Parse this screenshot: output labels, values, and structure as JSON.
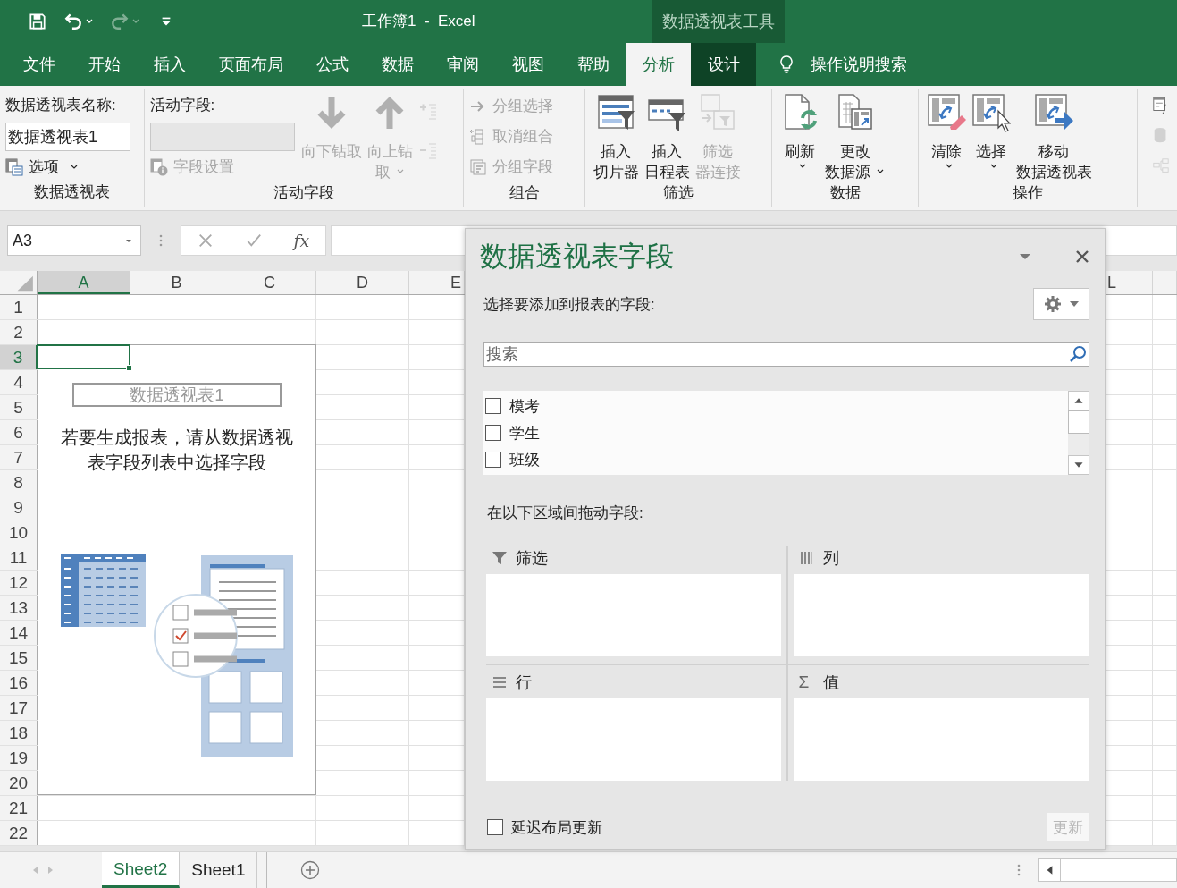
{
  "window": {
    "title": "工作簿1  -  Excel",
    "context_title": "数据透视表工具"
  },
  "quick_access": [
    {
      "kind": "save",
      "disabled": false
    },
    {
      "kind": "undo",
      "disabled": false
    },
    {
      "kind": "redo",
      "disabled": true
    },
    {
      "kind": "customize",
      "disabled": false
    }
  ],
  "tabs": [
    {
      "label": "文件",
      "selected": false,
      "contextual": false
    },
    {
      "label": "开始",
      "selected": false,
      "contextual": false
    },
    {
      "label": "插入",
      "selected": false,
      "contextual": false
    },
    {
      "label": "页面布局",
      "selected": false,
      "contextual": false
    },
    {
      "label": "公式",
      "selected": false,
      "contextual": false
    },
    {
      "label": "数据",
      "selected": false,
      "contextual": false
    },
    {
      "label": "审阅",
      "selected": false,
      "contextual": false
    },
    {
      "label": "视图",
      "selected": false,
      "contextual": false
    },
    {
      "label": "帮助",
      "selected": false,
      "contextual": false
    },
    {
      "label": "分析",
      "selected": true,
      "contextual": true
    },
    {
      "label": "设计",
      "selected": false,
      "contextual": true
    }
  ],
  "tell_me": "操作说明搜索",
  "ribbon": {
    "groups": [
      {
        "kind": "pivot",
        "label": "数据透视表",
        "name_label": "数据透视表名称:",
        "name_value": "数据透视表1",
        "options": {
          "kind": "options",
          "label": "选项",
          "dropdown": true,
          "disabled": false
        }
      },
      {
        "kind": "active-field",
        "label": "活动字段",
        "field_label": "活动字段:",
        "settings": {
          "kind": "field-settings",
          "label": "字段设置",
          "disabled": true
        },
        "items": [
          {
            "kind": "drill-down",
            "lines": [
              "向下钻取"
            ],
            "dropdown": false,
            "disabled": true
          },
          {
            "kind": "drill-up",
            "lines": [
              "向上钻",
              "取"
            ],
            "dropdown": true,
            "disabled": true
          }
        ],
        "small": [
          {
            "kind": "expand",
            "disabled": true
          },
          {
            "kind": "collapse",
            "disabled": true
          }
        ]
      },
      {
        "kind": "small-list",
        "label": "组合",
        "items": [
          {
            "kind": "group-selection",
            "label": "分组选择",
            "disabled": true
          },
          {
            "kind": "ungroup",
            "label": "取消组合",
            "disabled": true
          },
          {
            "kind": "group-field",
            "label": "分组字段",
            "disabled": true
          }
        ]
      },
      {
        "kind": "large",
        "label": "筛选",
        "items": [
          {
            "kind": "slicer",
            "lines": [
              "插入",
              "切片器"
            ],
            "dropdown": false,
            "disabled": false
          },
          {
            "kind": "timeline",
            "lines": [
              "插入",
              "日程表"
            ],
            "dropdown": false,
            "disabled": false
          },
          {
            "kind": "filter-connection",
            "lines": [
              "筛选",
              "器连接"
            ],
            "dropdown": false,
            "disabled": true
          }
        ]
      },
      {
        "kind": "large",
        "label": "数据",
        "items": [
          {
            "kind": "refresh",
            "lines": [
              "刷新"
            ],
            "dropdown": true,
            "disabled": false
          },
          {
            "kind": "change-source",
            "lines": [
              "更改",
              "数据源"
            ],
            "dropdown": true,
            "disabled": false
          }
        ]
      },
      {
        "kind": "large",
        "label": "操作",
        "items": [
          {
            "kind": "clear",
            "lines": [
              "清除"
            ],
            "dropdown": true,
            "disabled": false
          },
          {
            "kind": "select",
            "lines": [
              "选择"
            ],
            "dropdown": true,
            "disabled": false
          },
          {
            "kind": "move",
            "lines": [
              "移动",
              "数据透视表"
            ],
            "dropdown": false,
            "disabled": false
          }
        ]
      },
      {
        "kind": "icons",
        "items": [
          {
            "kind": "calc-field",
            "disabled": false
          },
          {
            "kind": "olap",
            "disabled": true
          },
          {
            "kind": "relations",
            "disabled": true
          }
        ]
      }
    ]
  },
  "formula_bar": {
    "name_box": "A3",
    "function_button": "fx"
  },
  "grid": {
    "columns": [
      {
        "label": "A",
        "selected": true
      },
      {
        "label": "B",
        "selected": false
      },
      {
        "label": "C",
        "selected": false
      },
      {
        "label": "D",
        "selected": false
      },
      {
        "label": "E",
        "selected": false
      },
      {
        "label": "L",
        "selected": false
      }
    ],
    "rows": [
      {
        "label": "1",
        "selected": false
      },
      {
        "label": "2",
        "selected": false
      },
      {
        "label": "3",
        "selected": true
      },
      {
        "label": "4",
        "selected": false
      },
      {
        "label": "5",
        "selected": false
      },
      {
        "label": "6",
        "selected": false
      },
      {
        "label": "7",
        "selected": false
      },
      {
        "label": "8",
        "selected": false
      },
      {
        "label": "9",
        "selected": false
      },
      {
        "label": "10",
        "selected": false
      },
      {
        "label": "11",
        "selected": false
      },
      {
        "label": "12",
        "selected": false
      },
      {
        "label": "13",
        "selected": false
      },
      {
        "label": "14",
        "selected": false
      },
      {
        "label": "15",
        "selected": false
      },
      {
        "label": "16",
        "selected": false
      },
      {
        "label": "17",
        "selected": false
      },
      {
        "label": "18",
        "selected": false
      },
      {
        "label": "19",
        "selected": false
      },
      {
        "label": "20",
        "selected": false
      },
      {
        "label": "21",
        "selected": false
      },
      {
        "label": "22",
        "selected": false
      }
    ]
  },
  "placeholder": {
    "caption": "数据透视表1",
    "instruction": "若要生成报表，请从数据透视表字段列表中选择字段"
  },
  "pane": {
    "title": "数据透视表字段",
    "choose_label": "选择要添加到报表的字段:",
    "search_placeholder": "搜索",
    "fields": [
      {
        "label": "模考",
        "checked": false
      },
      {
        "label": "学生",
        "checked": false
      },
      {
        "label": "班级",
        "checked": false
      }
    ],
    "drag_label": "在以下区域间拖动字段:",
    "areas": [
      {
        "kind": "filter",
        "label": "筛选"
      },
      {
        "kind": "columns",
        "label": "列"
      },
      {
        "kind": "rows",
        "label": "行"
      },
      {
        "kind": "values",
        "label": "值",
        "symbol": "Σ"
      }
    ],
    "defer": {
      "label": "延迟布局更新",
      "checked": false
    },
    "update_button": {
      "label": "更新",
      "disabled": true
    }
  },
  "sheets": [
    {
      "label": "Sheet2",
      "selected": true
    },
    {
      "label": "Sheet1",
      "selected": false
    }
  ]
}
